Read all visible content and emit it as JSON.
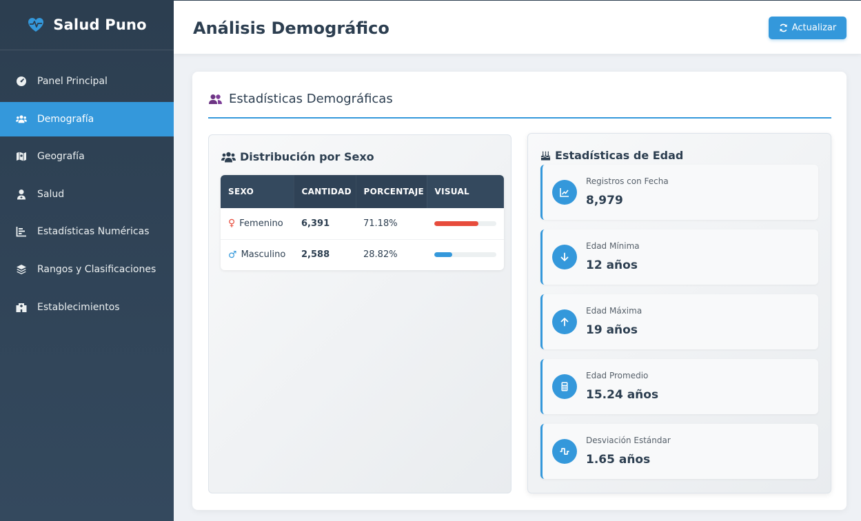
{
  "brand": {
    "name": "Salud Puno",
    "icon": "heart-pulse-icon",
    "icon_color": "#3498db"
  },
  "sidebar": {
    "items": [
      {
        "label": "Panel Principal",
        "icon": "tachometer-icon",
        "active": false
      },
      {
        "label": "Demografía",
        "icon": "users-icon",
        "active": true
      },
      {
        "label": "Geografía",
        "icon": "map-icon",
        "active": false
      },
      {
        "label": "Salud",
        "icon": "user-doctor-icon",
        "active": false
      },
      {
        "label": "Estadísticas Numéricas",
        "icon": "chart-bar-icon",
        "active": false
      },
      {
        "label": "Rangos y Clasificaciones",
        "icon": "layers-icon",
        "active": false
      },
      {
        "label": "Establecimientos",
        "icon": "hospital-icon",
        "active": false
      }
    ]
  },
  "header": {
    "title": "Análisis Demográfico",
    "refresh_label": "Actualizar",
    "refresh_icon": "sync-icon"
  },
  "section": {
    "title": "Estadísticas Demográficas",
    "icon": "user-friends-icon",
    "icon_color": "#6c3483"
  },
  "sex_panel": {
    "title": "Distribución por Sexo",
    "icon": "users-icon",
    "columns": [
      "SEXO",
      "CANTIDAD",
      "PORCENTAJE",
      "VISUAL"
    ],
    "rows": [
      {
        "sex": "Femenino",
        "symbol": "♀",
        "symbol_color": "#e74c3c",
        "count": "6,391",
        "percent": "71.18%",
        "fraction": 0.7118,
        "bar_color": "#e74c3c"
      },
      {
        "sex": "Masculino",
        "symbol": "♂",
        "symbol_color": "#3498db",
        "count": "2,588",
        "percent": "28.82%",
        "fraction": 0.2882,
        "bar_color": "#3498db"
      }
    ]
  },
  "age_panel": {
    "title": "Estadísticas de Edad",
    "icon": "birthday-cake-icon",
    "stats": [
      {
        "label": "Registros con Fecha",
        "value": "8,979",
        "icon": "chart-line-icon"
      },
      {
        "label": "Edad Mínima",
        "value": "12 años",
        "icon": "arrow-down-icon"
      },
      {
        "label": "Edad Máxima",
        "value": "19 años",
        "icon": "arrow-up-icon"
      },
      {
        "label": "Edad Promedio",
        "value": "15.24 años",
        "icon": "calculator-icon"
      },
      {
        "label": "Desviación Estándar",
        "value": "1.65 años",
        "icon": "wave-square-icon"
      }
    ]
  }
}
